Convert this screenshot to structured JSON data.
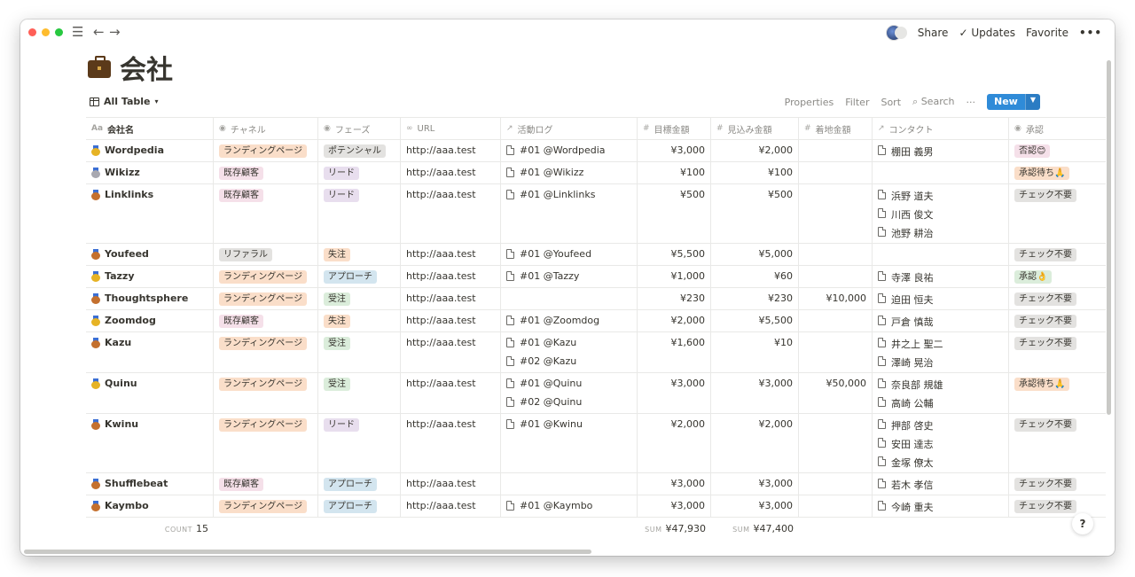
{
  "topbar": {
    "share": "Share",
    "updates": "Updates",
    "favorite": "Favorite",
    "more": "•••"
  },
  "page": {
    "title": "会社"
  },
  "view": {
    "name": "All Table",
    "properties": "Properties",
    "filter": "Filter",
    "sort": "Sort",
    "search": "Search",
    "more": "···",
    "new": "New"
  },
  "columns": [
    "会社名",
    "チャネル",
    "フェーズ",
    "URL",
    "活動ログ",
    "目標金額",
    "見込み金額",
    "着地金額",
    "コンタクト",
    "承認"
  ],
  "colors": {
    "landing": "#fadec9",
    "existing": "#f5e0e9",
    "referral": "#e3e2e0",
    "potential": "#e3e2e0",
    "lead": "#e8deee",
    "lost": "#fadec9",
    "approach": "#d3e5ef",
    "won": "#dbeddb",
    "check": "#e3e2e0",
    "denied": "#f5e0e9",
    "pending": "#fadec9",
    "approved": "#dbeddb"
  },
  "rows": [
    {
      "name": "Wordpedia",
      "medal": "#e6b325",
      "channel": "ランディングページ",
      "ch_color": "#fadec9",
      "phase": "ポテンシャル",
      "ph_color": "#e3e2e0",
      "url": "http://aaa.test",
      "logs": [
        "#01 @Wordpedia"
      ],
      "goal": "¥3,000",
      "est": "¥2,000",
      "land": "",
      "contacts": [
        "棚田 義男"
      ],
      "approval": "否認😊",
      "ap_color": "#f5e0e9"
    },
    {
      "name": "Wikizz",
      "medal": "#a8a8b0",
      "channel": "既存顧客",
      "ch_color": "#f5e0e9",
      "phase": "リード",
      "ph_color": "#e8deee",
      "url": "http://aaa.test",
      "logs": [
        "#01 @Wikizz"
      ],
      "goal": "¥100",
      "est": "¥100",
      "land": "",
      "contacts": [],
      "approval": "承認待ち🙏",
      "ap_color": "#fadec9"
    },
    {
      "name": "Linklinks",
      "medal": "#c4702e",
      "channel": "既存顧客",
      "ch_color": "#f5e0e9",
      "phase": "リード",
      "ph_color": "#e8deee",
      "url": "http://aaa.test",
      "logs": [
        "#01 @Linklinks"
      ],
      "goal": "¥500",
      "est": "¥500",
      "land": "",
      "contacts": [
        "浜野 道夫",
        "川西 俊文",
        "池野 耕治"
      ],
      "approval": "チェック不要",
      "ap_color": "#e3e2e0"
    },
    {
      "name": "Youfeed",
      "medal": "#c4702e",
      "channel": "リファラル",
      "ch_color": "#e3e2e0",
      "phase": "失注",
      "ph_color": "#fadec9",
      "url": "http://aaa.test",
      "logs": [
        "#01 @Youfeed"
      ],
      "goal": "¥5,500",
      "est": "¥5,000",
      "land": "",
      "contacts": [],
      "approval": "チェック不要",
      "ap_color": "#e3e2e0"
    },
    {
      "name": "Tazzy",
      "medal": "#e6b325",
      "channel": "ランディングページ",
      "ch_color": "#fadec9",
      "phase": "アプローチ",
      "ph_color": "#d3e5ef",
      "url": "http://aaa.test",
      "logs": [
        "#01 @Tazzy"
      ],
      "goal": "¥1,000",
      "est": "¥60",
      "land": "",
      "contacts": [
        "寺澤 良祐"
      ],
      "approval": "承認👌",
      "ap_color": "#dbeddb"
    },
    {
      "name": "Thoughtsphere",
      "medal": "#c4702e",
      "channel": "ランディングページ",
      "ch_color": "#fadec9",
      "phase": "受注",
      "ph_color": "#dbeddb",
      "url": "http://aaa.test",
      "logs": [],
      "goal": "¥230",
      "est": "¥230",
      "land": "¥10,000",
      "contacts": [
        "迫田 恒夫"
      ],
      "approval": "チェック不要",
      "ap_color": "#e3e2e0"
    },
    {
      "name": "Zoomdog",
      "medal": "#e6b325",
      "channel": "既存顧客",
      "ch_color": "#f5e0e9",
      "phase": "失注",
      "ph_color": "#fadec9",
      "url": "http://aaa.test",
      "logs": [
        "#01 @Zoomdog"
      ],
      "goal": "¥2,000",
      "est": "¥5,500",
      "land": "",
      "contacts": [
        "戸倉 慎哉"
      ],
      "approval": "チェック不要",
      "ap_color": "#e3e2e0"
    },
    {
      "name": "Kazu",
      "medal": "#c4702e",
      "channel": "ランディングページ",
      "ch_color": "#fadec9",
      "phase": "受注",
      "ph_color": "#dbeddb",
      "url": "http://aaa.test",
      "logs": [
        "#01 @Kazu",
        "#02 @Kazu"
      ],
      "goal": "¥1,600",
      "est": "¥10",
      "land": "",
      "contacts": [
        "井之上 聖二",
        "澤崎 晃治"
      ],
      "approval": "チェック不要",
      "ap_color": "#e3e2e0"
    },
    {
      "name": "Quinu",
      "medal": "#e6b325",
      "channel": "ランディングページ",
      "ch_color": "#fadec9",
      "phase": "受注",
      "ph_color": "#dbeddb",
      "url": "http://aaa.test",
      "logs": [
        "#01 @Quinu",
        "#02 @Quinu"
      ],
      "goal": "¥3,000",
      "est": "¥3,000",
      "land": "¥50,000",
      "contacts": [
        "奈良部 規雄",
        "高崎 公輔"
      ],
      "approval": "承認待ち🙏",
      "ap_color": "#fadec9"
    },
    {
      "name": "Kwinu",
      "medal": "#c4702e",
      "channel": "ランディングページ",
      "ch_color": "#fadec9",
      "phase": "リード",
      "ph_color": "#e8deee",
      "url": "http://aaa.test",
      "logs": [
        "#01 @Kwinu"
      ],
      "goal": "¥2,000",
      "est": "¥2,000",
      "land": "",
      "contacts": [
        "押部 啓史",
        "安田 達志",
        "金塚 僚太"
      ],
      "approval": "チェック不要",
      "ap_color": "#e3e2e0"
    },
    {
      "name": "Shufflebeat",
      "medal": "#c4702e",
      "channel": "既存顧客",
      "ch_color": "#f5e0e9",
      "phase": "アプローチ",
      "ph_color": "#d3e5ef",
      "url": "http://aaa.test",
      "logs": [],
      "goal": "¥3,000",
      "est": "¥3,000",
      "land": "",
      "contacts": [
        "若木 孝信"
      ],
      "approval": "チェック不要",
      "ap_color": "#e3e2e0"
    },
    {
      "name": "Kaymbo",
      "medal": "#c4702e",
      "channel": "ランディングページ",
      "ch_color": "#fadec9",
      "phase": "アプローチ",
      "ph_color": "#d3e5ef",
      "url": "http://aaa.test",
      "logs": [
        "#01 @Kaymbo"
      ],
      "goal": "¥3,000",
      "est": "¥3,000",
      "land": "",
      "contacts": [
        "今崎 重夫"
      ],
      "approval": "チェック不要",
      "ap_color": "#e3e2e0"
    }
  ],
  "footer": {
    "count_label": "COUNT",
    "count": "15",
    "sum_label": "SUM",
    "goal_sum": "¥47,930",
    "est_sum": "¥47,400"
  },
  "help": "?"
}
